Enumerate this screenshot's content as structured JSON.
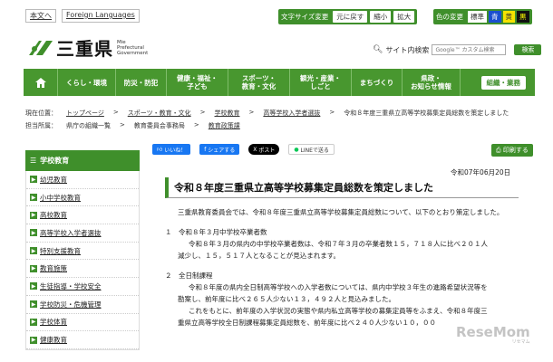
{
  "util": {
    "home_text": "本文へ",
    "foreign": "Foreign Languages"
  },
  "fontsize": {
    "title": "文字サイズ変更",
    "buttons": [
      "元に戻す",
      "縮小",
      "拡大"
    ]
  },
  "color": {
    "title": "色の変更",
    "options": [
      "標準",
      "青",
      "黄",
      "黒"
    ]
  },
  "logo": {
    "name": "三重県",
    "en1": "Mie",
    "en2": "Prefectural",
    "en3": "Government"
  },
  "search": {
    "label": "サイト内検索",
    "placeholder": "Google™ カスタム検索",
    "button": "検索"
  },
  "nav": {
    "home_icon": "home-icon",
    "items": [
      "くらし・環境",
      "防災・防犯",
      "健康・福祉・\n子ども",
      "スポーツ・\n教育・文化",
      "観光・産業・\nしごと",
      "まちづくり",
      "県政・\nお知らせ情報"
    ],
    "org": "組織・業務"
  },
  "crumbs": {
    "current_label": "現在位置：",
    "path": [
      "トップページ",
      "スポーツ・教育・文化",
      "学校教育",
      "高等学校入学者選抜"
    ],
    "current": "令和８年度三重県立高等学校募集定員総数を策定しました",
    "dept_label": "担当所属：",
    "dept": [
      "県庁の組織一覧",
      "教育委員会事務局",
      "教育政策課"
    ]
  },
  "sidebar": {
    "heading": "学校教育",
    "items": [
      "幼児教育",
      "小中学校教育",
      "高校教育",
      "高等学校入学者選抜",
      "特別支援教育",
      "教育施策",
      "生徒指導・学校安全",
      "学校防災・危機管理",
      "学校体育",
      "健康教育"
    ]
  },
  "share": {
    "like": "いいね！",
    "share": "シェアする",
    "post": "ポスト",
    "line": "LINEで送る",
    "print": "印刷する"
  },
  "article": {
    "date": "令和07年06月20日",
    "title": "令和８年度三重県立高等学校募集定員総数を策定しました",
    "intro": "三重県教育委員会では、令和８年度三重県立高等学校募集定員総数について、以下のとおり策定しました。",
    "s1_head": "１　令和８年３月中学校卒業者数",
    "s1_l1": "令和８年３月の県内の中学校卒業者数は、令和７年３月の卒業者数１５，７１８人に比べ２０１人",
    "s1_l2": "減少し、１５，５１７人となることが見込まれます。",
    "s2_head": "２　全日制課程",
    "s2_l1": "令和８年度の県内全日制高等学校への入学者数については、県内中学校３年生の進路希望状況等を",
    "s2_l2": "勘案し、前年度に比べ２６５人少ない１３，４９２人と見込みました。",
    "s2_l3": "これをもとに、前年度の入学状況の実態や県内私立高等学校の募集定員等をふまえ、令和８年度三",
    "s2_l4": "重県立高等学校全日制課程募集定員総数を、前年度に比べ２４０人少ない１０，００"
  },
  "watermark": {
    "text": "ReseMom",
    "sub": "リセマム"
  },
  "colors": {
    "green": "#3f8f2b",
    "nav_green": "#48972f"
  }
}
